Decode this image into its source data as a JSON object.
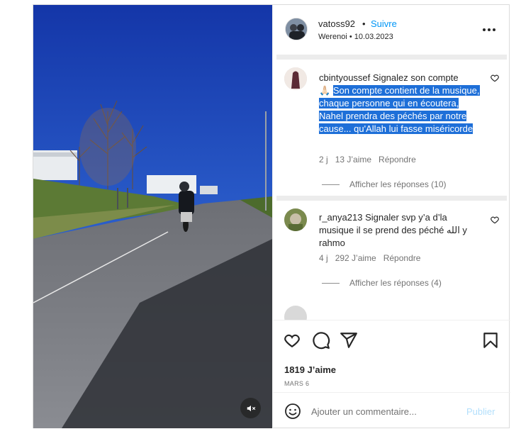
{
  "post": {
    "username": "vatoss92",
    "follow_label": "Suivre",
    "subtitle": "Werenoi • 10.03.2023",
    "likes": "1819 J’aime",
    "date": "MARS 6",
    "comment_placeholder": "Ajouter un commentaire...",
    "publish_label": "Publier"
  },
  "comments": [
    {
      "username": "cbintyoussef",
      "text_plain": "Signalez son compte",
      "emoji": "🙏🏻",
      "text_highlighted": "Son compte contient de la musique, chaque personne qui en écoutera, Nahel prendra des péchés par notre cause... qu'Allah lui fasse miséricorde",
      "age": "2 j",
      "likes": "13 J’aime",
      "reply_label": "Répondre",
      "replies_label": "Afficher les réponses (10)"
    },
    {
      "username": "r_anya213",
      "text_plain": "Signaler svp y’a d’la musique il se prend des péché الله y rahmo",
      "age": "4 j",
      "likes": "292 J’aime",
      "reply_label": "Répondre",
      "replies_label": "Afficher les réponses (4)"
    }
  ],
  "icons": {
    "more": "more-options-icon",
    "heart": "heart-icon",
    "comment": "comment-icon",
    "share": "share-icon",
    "save": "bookmark-icon",
    "emoji": "emoji-icon",
    "mute": "muted-speaker-icon"
  },
  "colors": {
    "accent": "#0095f6",
    "publish_disabled": "#b2dffc",
    "highlight": "#1e6fd8",
    "sky": "#1b3e9c"
  }
}
